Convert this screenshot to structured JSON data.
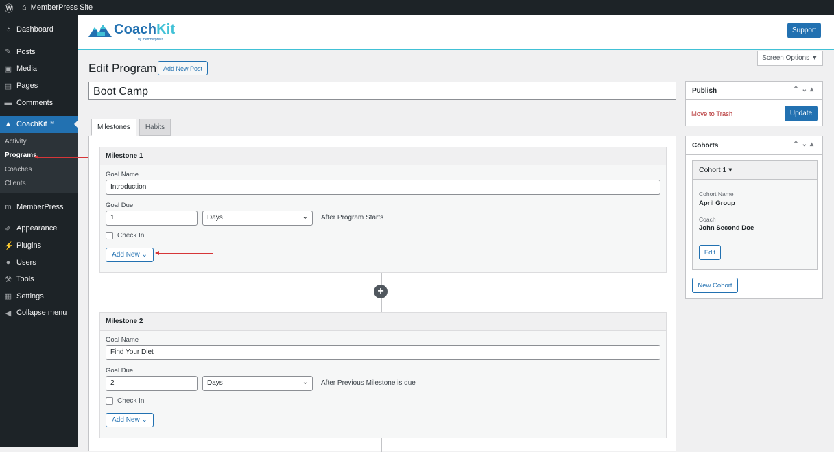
{
  "topbar": {
    "site_name": "MemberPress Site"
  },
  "sidebar": {
    "items": [
      {
        "label": "Dashboard",
        "icon": "dashboard-icon"
      },
      {
        "label": "Posts",
        "icon": "pin-icon"
      },
      {
        "label": "Media",
        "icon": "media-icon"
      },
      {
        "label": "Pages",
        "icon": "pages-icon"
      },
      {
        "label": "Comments",
        "icon": "comment-icon"
      },
      {
        "label": "CoachKit™",
        "icon": "coachkit-icon"
      },
      {
        "label": "MemberPress",
        "icon": "memberpress-icon"
      },
      {
        "label": "Appearance",
        "icon": "brush-icon"
      },
      {
        "label": "Plugins",
        "icon": "plug-icon"
      },
      {
        "label": "Users",
        "icon": "user-icon"
      },
      {
        "label": "Tools",
        "icon": "wrench-icon"
      },
      {
        "label": "Settings",
        "icon": "settings-icon"
      },
      {
        "label": "Collapse menu",
        "icon": "collapse-icon"
      }
    ],
    "submenu": [
      "Activity",
      "Programs",
      "Coaches",
      "Clients"
    ]
  },
  "header": {
    "logo_text_a": "Coach",
    "logo_text_b": "Kit",
    "logo_by": "by memberpress",
    "support_label": "Support"
  },
  "screen_options": "Screen Options ▼",
  "page": {
    "title": "Edit Program",
    "add_new_post": "Add New Post",
    "post_title": "Boot Camp"
  },
  "tabs": [
    "Milestones",
    "Habits"
  ],
  "milestones": [
    {
      "title": "Milestone 1",
      "goal_label": "Goal Name",
      "goal_value": "Introduction",
      "due_label": "Goal Due",
      "due_value": "1",
      "unit": "Days",
      "after": "After Program Starts",
      "checkin": "Check In",
      "add_new": "Add New"
    },
    {
      "title": "Milestone 2",
      "goal_label": "Goal Name",
      "goal_value": "Find Your Diet",
      "due_label": "Goal Due",
      "due_value": "2",
      "unit": "Days",
      "after": "After Previous Milestone is due",
      "checkin": "Check In",
      "add_new": "Add New"
    }
  ],
  "publish": {
    "title": "Publish",
    "trash": "Move to Trash",
    "update": "Update"
  },
  "cohorts": {
    "title": "Cohorts",
    "card_title": "Cohort 1 ▾",
    "name_label": "Cohort Name",
    "name_value": "April Group",
    "coach_label": "Coach",
    "coach_value": "John Second Doe",
    "edit": "Edit",
    "new_cohort": "New Cohort"
  },
  "colors": {
    "accent": "#2271b1",
    "sidebar": "#1d2327",
    "brand_teal": "#41c1d6",
    "arrow": "#d63638"
  }
}
